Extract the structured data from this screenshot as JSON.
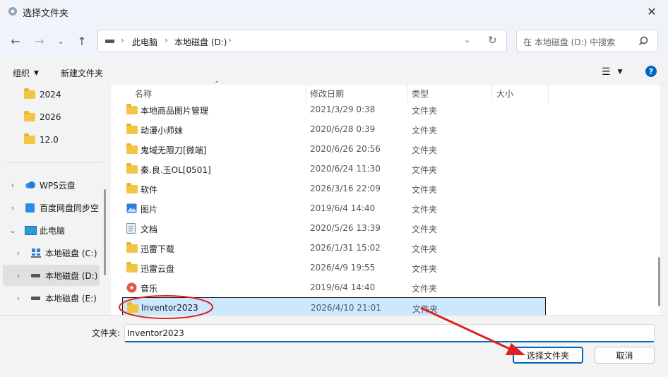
{
  "window": {
    "title": "选择文件夹"
  },
  "address": {
    "segments": [
      "此电脑",
      "本地磁盘 (D:)"
    ]
  },
  "search": {
    "placeholder": "在 本地磁盘 (D:) 中搜索"
  },
  "toolbar": {
    "organize": "组织",
    "new_folder": "新建文件夹"
  },
  "sidebar": {
    "items": [
      {
        "label": "2024"
      },
      {
        "label": "2026"
      },
      {
        "label": "12.0"
      },
      {
        "label": "WPS云盘"
      },
      {
        "label": "百度网盘同步空"
      },
      {
        "label": "此电脑"
      },
      {
        "label": "本地磁盘 (C:)"
      },
      {
        "label": "本地磁盘 (D:)"
      },
      {
        "label": "本地磁盘 (E:)"
      }
    ]
  },
  "columns": {
    "name": "名称",
    "modified": "修改日期",
    "type": "类型",
    "size": "大小"
  },
  "files": [
    {
      "name": "本地商品图片管理",
      "modified": "2021/3/29 0:38",
      "type": "文件夹",
      "icon": "folder-icon"
    },
    {
      "name": "动漫小师妹",
      "modified": "2020/6/28 0:39",
      "type": "文件夹",
      "icon": "folder-icon"
    },
    {
      "name": "鬼域无限刀[微端]",
      "modified": "2020/6/26 20:56",
      "type": "文件夹",
      "icon": "folder-icon"
    },
    {
      "name": "秦.良.玉OL[0501]",
      "modified": "2020/6/24 11:30",
      "type": "文件夹",
      "icon": "folder-icon"
    },
    {
      "name": "软件",
      "modified": "2026/3/16 22:09",
      "type": "文件夹",
      "icon": "folder-icon"
    },
    {
      "name": "图片",
      "modified": "2019/6/4 14:40",
      "type": "文件夹",
      "icon": "pictures-icon"
    },
    {
      "name": "文档",
      "modified": "2020/5/26 13:39",
      "type": "文件夹",
      "icon": "documents-icon"
    },
    {
      "name": "迅雷下载",
      "modified": "2026/1/31 15:02",
      "type": "文件夹",
      "icon": "folder-icon"
    },
    {
      "name": "迅雷云盘",
      "modified": "2026/4/9 19:55",
      "type": "文件夹",
      "icon": "folder-icon"
    },
    {
      "name": "音乐",
      "modified": "2019/6/4 14:40",
      "type": "文件夹",
      "icon": "music-icon"
    },
    {
      "name": "Inventor2023",
      "modified": "2026/4/10 21:01",
      "type": "文件夹",
      "icon": "folder-icon",
      "selected": true
    }
  ],
  "footer": {
    "folder_label": "文件夹:",
    "folder_value": "Inventor2023",
    "select_button": "选择文件夹",
    "cancel_button": "取消"
  },
  "colors": {
    "accent": "#0067c0",
    "selection": "#cce8ff",
    "annotation": "#e02020"
  }
}
